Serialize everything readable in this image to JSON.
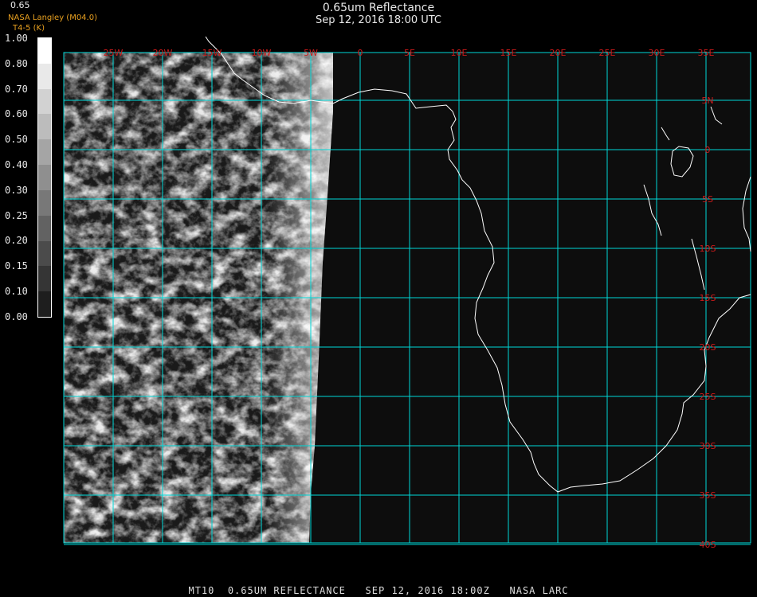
{
  "header": {
    "title": "0.65um Reflectance",
    "subtitle": "Sep 12, 2016 18:00 UTC",
    "product_code": "0.65",
    "credit_line1": "NASA Langley (M04.0)",
    "credit_line2": "T4-5 (K)"
  },
  "colorbar": {
    "ticks": [
      "1.00",
      "0.80",
      "0.70",
      "0.60",
      "0.50",
      "0.40",
      "0.30",
      "0.25",
      "0.20",
      "0.15",
      "0.10",
      "0.00"
    ]
  },
  "map": {
    "lon_labels": [
      "25W",
      "20W",
      "15W",
      "10W",
      "5W",
      "0",
      "5E",
      "10E",
      "15E",
      "20E",
      "25E",
      "30E",
      "35E"
    ],
    "lat_labels": [
      "5N",
      "0",
      "5S",
      "10S",
      "15S",
      "20S",
      "25S",
      "30S",
      "35S",
      "40S"
    ],
    "grid_color": "#00d8d8",
    "label_color": "#cc1a1a",
    "coast_color": "#ffffff"
  },
  "footer": {
    "text": "MT10  0.65UM REFLECTANCE   SEP 12, 2016 18:00Z   NASA LARC"
  }
}
